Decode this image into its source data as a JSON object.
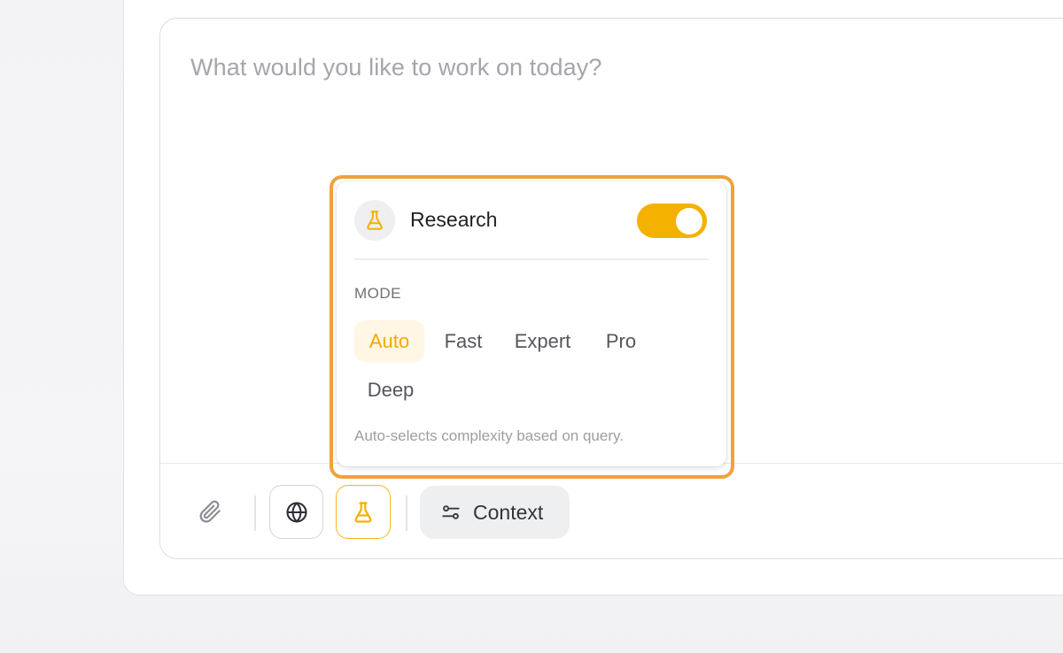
{
  "composer": {
    "placeholder": "What would you like to work on today?"
  },
  "toolbar": {
    "attach_icon": "paperclip-icon",
    "web_icon": "globe-icon",
    "research_icon": "flask-icon",
    "context_icon": "sliders-icon",
    "context_label": "Context"
  },
  "research_popover": {
    "icon": "flask-icon",
    "title": "Research",
    "toggle_on": true,
    "mode_heading": "MODE",
    "modes": [
      {
        "label": "Auto",
        "active": true
      },
      {
        "label": "Fast",
        "active": false
      },
      {
        "label": "Expert",
        "active": false
      },
      {
        "label": "Pro",
        "active": false
      },
      {
        "label": "Deep",
        "active": false
      }
    ],
    "hint": "Auto-selects complexity based on query."
  },
  "colors": {
    "accent": "#f5b100",
    "highlight_frame": "#f0a23b",
    "active_mode_bg": "#fff6e3"
  }
}
